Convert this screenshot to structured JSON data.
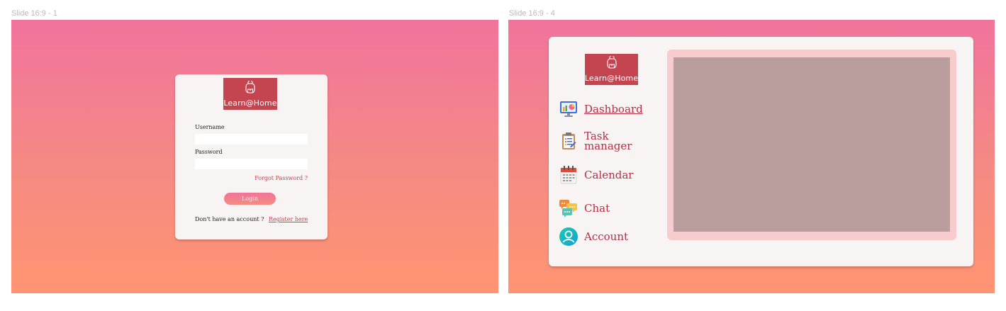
{
  "frames": {
    "login_frame_label": "Slide 16:9 - 1",
    "dashboard_frame_label": "Slide 16:9 - 4"
  },
  "brand": {
    "name": "Learn@Home",
    "logo_icon": "backpack-icon",
    "logo_color": "#c4444f"
  },
  "login": {
    "username_label": "Username",
    "username_value": "",
    "password_label": "Password",
    "password_value": "",
    "forgot_password": "Forgot Password ?",
    "login_button": "Login",
    "no_account_text": "Don't have an account ?",
    "register_link": "Register here"
  },
  "dashboard": {
    "nav": [
      {
        "label": "Dashboard",
        "icon": "dashboard-chart-icon",
        "active": true
      },
      {
        "label": "Task manager",
        "icon": "clipboard-icon",
        "active": false
      },
      {
        "label": "Calendar",
        "icon": "calendar-icon",
        "active": false
      },
      {
        "label": "Chat",
        "icon": "chat-bubbles-icon",
        "active": false
      },
      {
        "label": "Account",
        "icon": "user-circle-icon",
        "active": false
      }
    ]
  },
  "colors": {
    "gradient_top": "#f1739c",
    "gradient_bottom": "#ff9472",
    "card_bg": "#f8f4f3",
    "accent": "#b52f45",
    "panel_outer": "#f8cccc",
    "panel_inner": "#ba9d9d"
  }
}
